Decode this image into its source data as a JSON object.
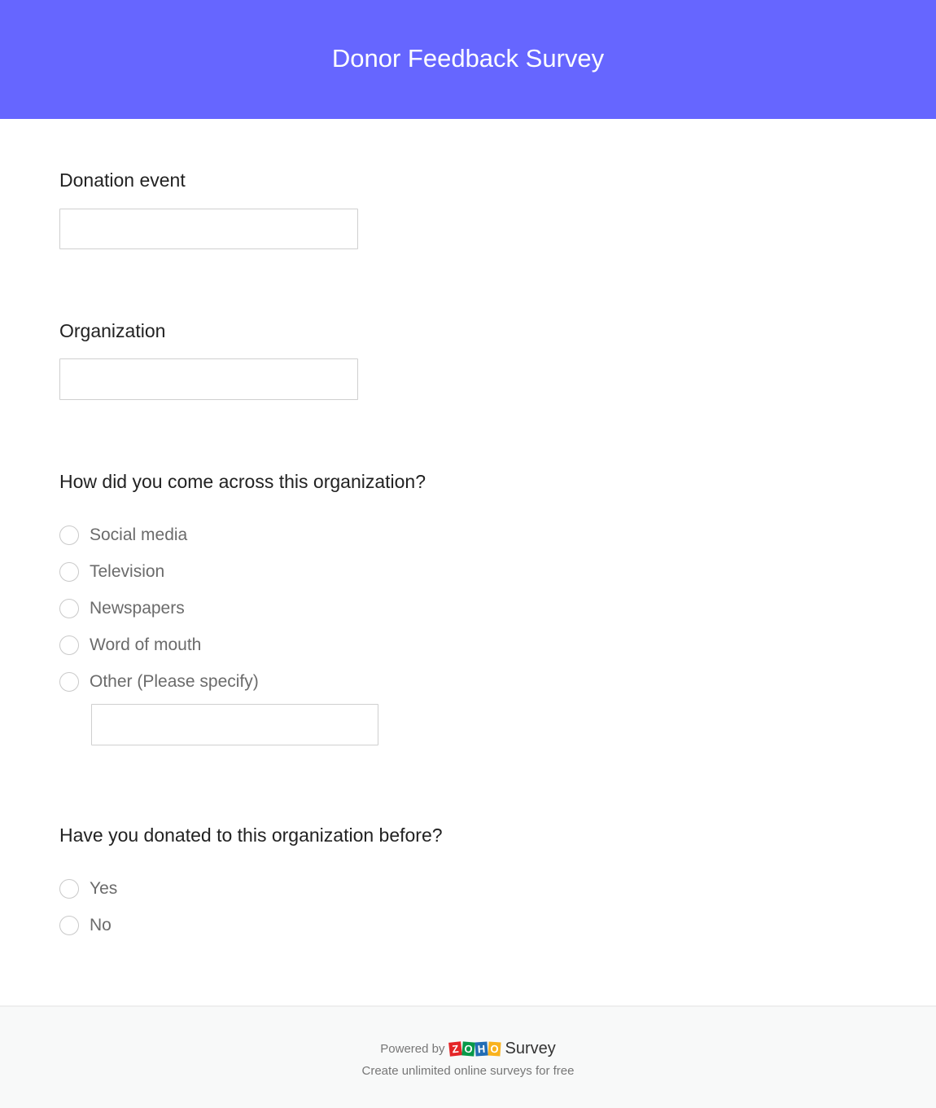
{
  "header": {
    "title": "Donor Feedback Survey",
    "background": "#6666ff"
  },
  "questions": [
    {
      "label": "Donation event",
      "type": "text",
      "value": "",
      "placeholder": ""
    },
    {
      "label": "Organization",
      "type": "text",
      "value": "",
      "placeholder": ""
    },
    {
      "label": "How did you come across this organization?",
      "type": "radio",
      "options": [
        {
          "label": "Social media",
          "selected": false
        },
        {
          "label": "Television",
          "selected": false
        },
        {
          "label": "Newspapers",
          "selected": false
        },
        {
          "label": "Word of mouth",
          "selected": false
        },
        {
          "label": "Other (Please specify)",
          "selected": false
        }
      ],
      "other_value": ""
    },
    {
      "label": "Have you donated to this organization before?",
      "type": "radio",
      "options": [
        {
          "label": "Yes",
          "selected": false
        },
        {
          "label": "No",
          "selected": false
        }
      ]
    }
  ],
  "footer": {
    "powered_by": "Powered by",
    "logo_letters": [
      {
        "char": "Z",
        "color": "#e42527"
      },
      {
        "char": "O",
        "color": "#089949"
      },
      {
        "char": "H",
        "color": "#226db4"
      },
      {
        "char": "O",
        "color": "#f9b21d"
      }
    ],
    "product": "Survey",
    "tagline": "Create unlimited online surveys for free"
  }
}
